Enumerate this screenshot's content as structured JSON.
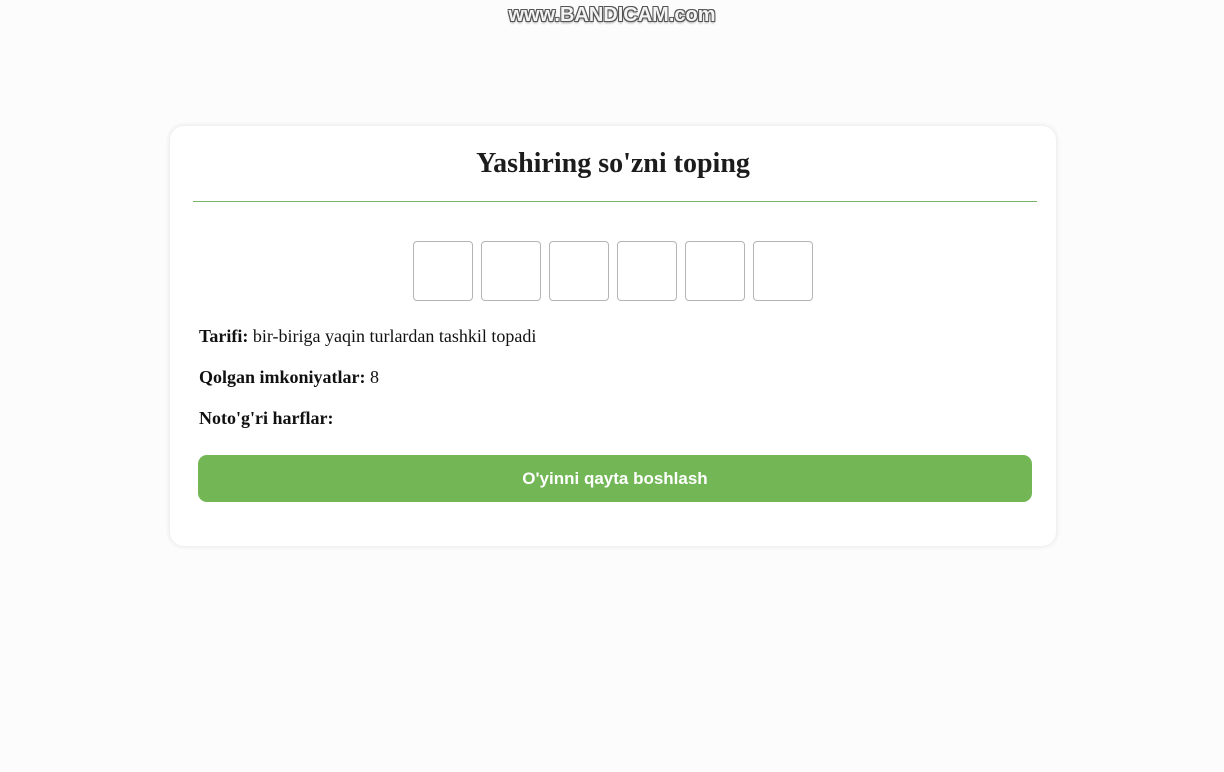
{
  "watermark": "www.BANDICAM.com",
  "game": {
    "title": "Yashiring so'zni toping",
    "letters": [
      "",
      "",
      "",
      "",
      "",
      ""
    ],
    "hint_label": "Tarifi:",
    "hint_value": "bir-biriga yaqin turlardan tashkil topadi",
    "tries_label": "Qolgan imkoniyatlar:",
    "tries_value": "8",
    "wrong_label": "Noto'g'ri harflar:",
    "wrong_value": "",
    "restart_label": "O'yinni qayta boshlash"
  },
  "colors": {
    "accent": "#72b655",
    "divider": "#7ab368",
    "background": "#fcfcfc"
  }
}
